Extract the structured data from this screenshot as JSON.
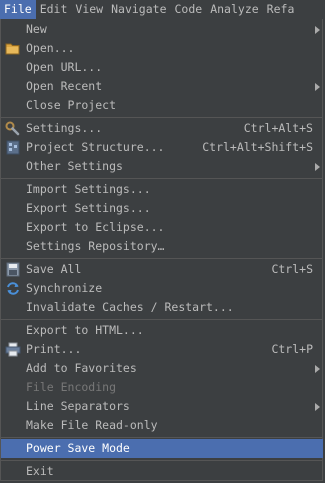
{
  "menubar": {
    "items": [
      "File",
      "Edit",
      "View",
      "Navigate",
      "Code",
      "Analyze",
      "Refa"
    ]
  },
  "file_menu": {
    "new": "New",
    "open": "Open...",
    "open_url": "Open URL...",
    "open_recent": "Open Recent",
    "close_project": "Close Project",
    "settings": "Settings...",
    "settings_shortcut": "Ctrl+Alt+S",
    "project_structure": "Project Structure...",
    "project_structure_shortcut": "Ctrl+Alt+Shift+S",
    "other_settings": "Other Settings",
    "import_settings": "Import Settings...",
    "export_settings": "Export Settings...",
    "export_to_eclipse": "Export to Eclipse...",
    "settings_repository": "Settings Repository…",
    "save_all": "Save All",
    "save_all_shortcut": "Ctrl+S",
    "synchronize": "Synchronize",
    "invalidate_caches": "Invalidate Caches / Restart...",
    "export_to_html": "Export to HTML...",
    "print": "Print...",
    "print_shortcut": "Ctrl+P",
    "add_to_favorites": "Add to Favorites",
    "file_encoding": "File Encoding",
    "line_separators": "Line Separators",
    "make_read_only": "Make File Read-only",
    "power_save_mode": "Power Save Mode",
    "exit": "Exit"
  },
  "colors": {
    "background": "#3c3f41",
    "selection": "#4b6eaf",
    "text": "#bbbbbb",
    "disabled_text": "#777777",
    "separator": "#555555"
  }
}
